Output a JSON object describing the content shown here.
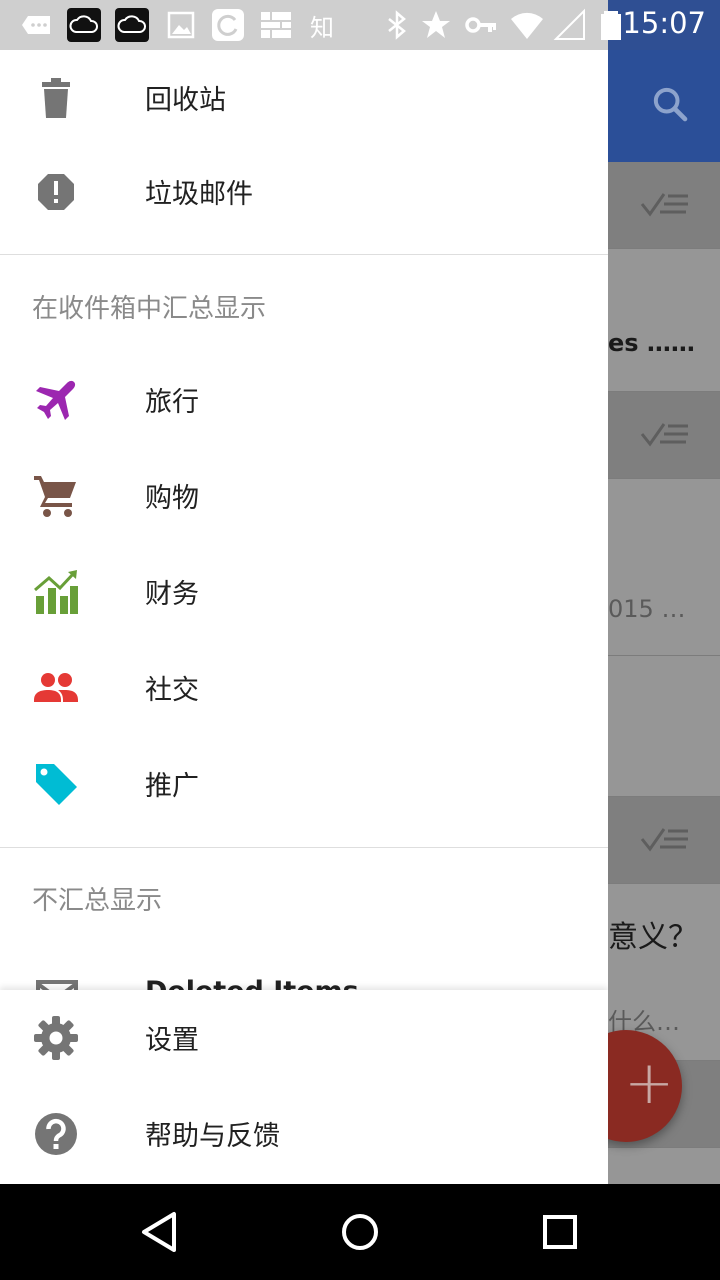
{
  "status_bar": {
    "time": "15:07",
    "zhi_label": "知",
    "icons": [
      "message-icon",
      "cloud-icon",
      "cloud-icon",
      "image-icon",
      "sync-icon",
      "grid-icon",
      "bluetooth-icon",
      "star-icon",
      "key-icon",
      "wifi-icon",
      "signal-icon",
      "battery-icon"
    ]
  },
  "drawer": {
    "top_items": [
      {
        "label": "回收站",
        "icon": "trash-icon"
      },
      {
        "label": "垃圾邮件",
        "icon": "spam-icon"
      }
    ],
    "bundled_header": "在收件箱中汇总显示",
    "bundled_items": [
      {
        "label": "旅行",
        "icon": "flight-icon",
        "color": "#9c27b0"
      },
      {
        "label": "购物",
        "icon": "cart-icon",
        "color": "#795548"
      },
      {
        "label": "财务",
        "icon": "finance-icon",
        "color": "#689f38"
      },
      {
        "label": "社交",
        "icon": "people-icon",
        "color": "#e53935"
      },
      {
        "label": "推广",
        "icon": "tag-icon",
        "color": "#00bcd4"
      }
    ],
    "unbundled_header": "不汇总显示",
    "partial_item": {
      "label": "Deleted Items",
      "icon": "mail-icon"
    },
    "footer_items": [
      {
        "label": "设置",
        "icon": "gear-icon"
      },
      {
        "label": "帮助与反馈",
        "icon": "help-icon"
      }
    ]
  },
  "background": {
    "snippet_1": "es ……",
    "snippet_2": "015 …",
    "snippet_3": "意义？",
    "snippet_4": "什么…"
  },
  "colors": {
    "appbar": "#3f6fd1",
    "fab": "#c0392b",
    "icon_grey": "#757575"
  }
}
